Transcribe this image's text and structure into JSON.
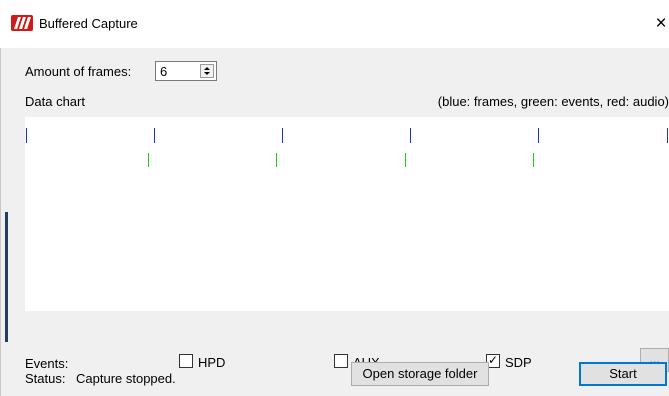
{
  "window": {
    "title": "Buffered Capture",
    "close_glyph": "×",
    "app_icon": "app-logo-icon"
  },
  "frames": {
    "label": "Amount of frames:",
    "value": "6"
  },
  "chart": {
    "label": "Data chart",
    "legend": "(blue: frames, green: events, red: audio)",
    "colors": {
      "frames": "#1f2fd0",
      "events": "#22c422",
      "audio": "#e02020"
    }
  },
  "chart_data": {
    "type": "scatter",
    "series": [
      {
        "name": "frames",
        "marker": "tick",
        "x": [
          1,
          129,
          258,
          386,
          515,
          644
        ]
      },
      {
        "name": "events",
        "marker": "tick",
        "x": [
          123,
          252,
          381,
          510
        ]
      },
      {
        "name": "audio",
        "marker": "tick",
        "x": []
      }
    ],
    "xlim": [
      0,
      644
    ]
  },
  "events": {
    "label": "Events:",
    "options": [
      {
        "label": "HPD",
        "checked": false
      },
      {
        "label": "AUX",
        "checked": false
      },
      {
        "label": "SDP",
        "checked": true
      }
    ],
    "more_label": "..."
  },
  "status": {
    "label": "Status:",
    "value": "Capture stopped."
  },
  "buttons": {
    "open_folder": "Open storage folder",
    "start": "Start"
  }
}
